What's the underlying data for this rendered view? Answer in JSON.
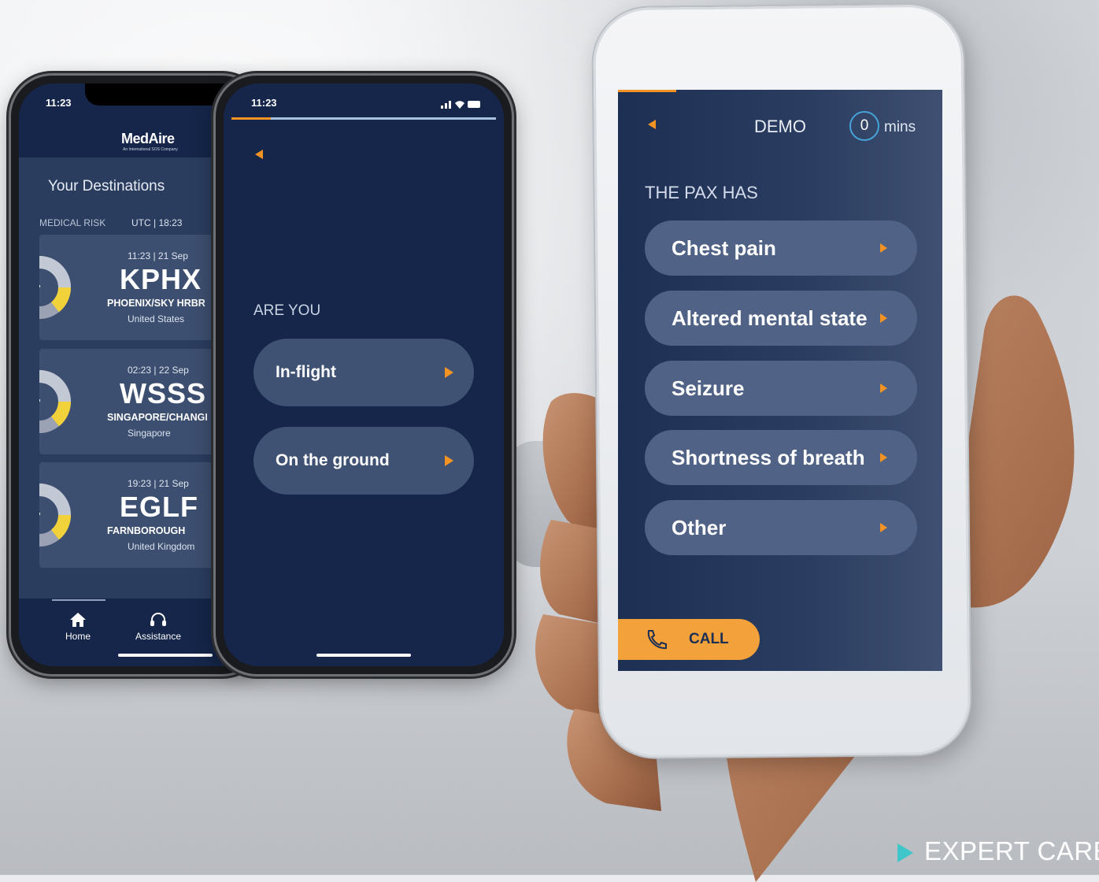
{
  "phone1": {
    "status_time": "11:23",
    "logo": "MedAire",
    "logo_sub": "An International SOS Company",
    "section_title": "Your Destinations",
    "risk_label": "MEDICAL RISK",
    "utc_label": "UTC | 18:23",
    "destinations": [
      {
        "time": "11:23 | 21 Sep",
        "code": "KPHX",
        "name": "PHOENIX/SKY HRBR",
        "country": "United States"
      },
      {
        "time": "02:23 | 22 Sep",
        "code": "WSSS",
        "name": "SINGAPORE/CHANGI",
        "country": "Singapore"
      },
      {
        "time": "19:23 | 21 Sep",
        "code": "EGLF",
        "name": "FARNBOROUGH",
        "country": "United Kingdom"
      }
    ],
    "tabs": [
      {
        "label": "Home",
        "icon": "home-icon"
      },
      {
        "label": "Assistance",
        "icon": "headset-icon"
      }
    ]
  },
  "phone2": {
    "status_time": "11:23",
    "question": "ARE YOU",
    "progress": 0.15,
    "options": [
      "In-flight",
      "On the ground"
    ]
  },
  "phone3": {
    "title": "DEMO",
    "timer_value": "0",
    "timer_unit": "mins",
    "question": "THE PAX HAS",
    "progress": 0.18,
    "options": [
      "Chest pain",
      "Altered mental state",
      "Seizure",
      "Shortness of breath",
      "Other"
    ],
    "call_label": "CALL"
  },
  "tagline": "EXPERT CARE.",
  "colors": {
    "navy": "#15264a",
    "accent": "#f39323",
    "teal": "#3fc6c9"
  }
}
